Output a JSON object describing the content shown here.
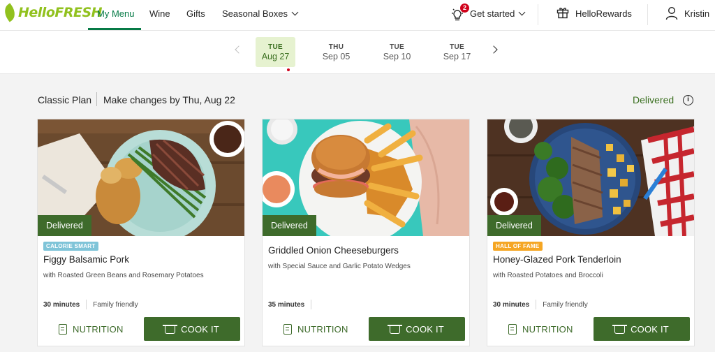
{
  "brand": {
    "name": "HelloFRESH",
    "color": "#91c11e"
  },
  "nav": {
    "items": [
      "My Menu",
      "Wine",
      "Gifts",
      "Seasonal Boxes"
    ],
    "active_color": "#067a46",
    "get_started": "Get started",
    "notification_count": "2",
    "rewards": "HelloRewards",
    "user": "Kristin"
  },
  "weeks": [
    {
      "dow": "TUE",
      "date": "Aug 27",
      "active": true
    },
    {
      "dow": "THU",
      "date": "Sep 05"
    },
    {
      "dow": "TUE",
      "date": "Sep 10"
    },
    {
      "dow": "TUE",
      "date": "Sep 17"
    }
  ],
  "plan": {
    "name": "Classic Plan",
    "deadline": "Make changes by Thu, Aug 22",
    "status": "Delivered"
  },
  "cards": [
    {
      "badge": "CALORIE SMART",
      "title": "Figgy Balsamic Pork",
      "subtitle": "with Roasted Green Beans and Rosemary Potatoes",
      "time": "30 minutes",
      "tag": "Family friendly",
      "status": "Delivered",
      "nutrition": "NUTRITION",
      "cook": "COOK IT"
    },
    {
      "title": "Griddled Onion Cheeseburgers",
      "subtitle": "with Special Sauce and Garlic Potato Wedges",
      "time": "35 minutes",
      "status": "Delivered",
      "nutrition": "NUTRITION",
      "cook": "COOK IT"
    },
    {
      "badge": "HALL OF FAME",
      "title": "Honey-Glazed Pork Tenderloin",
      "subtitle": "with Roasted Potatoes and Broccoli",
      "time": "30 minutes",
      "tag": "Family friendly",
      "status": "Delivered",
      "nutrition": "NUTRITION",
      "cook": "COOK IT"
    }
  ]
}
